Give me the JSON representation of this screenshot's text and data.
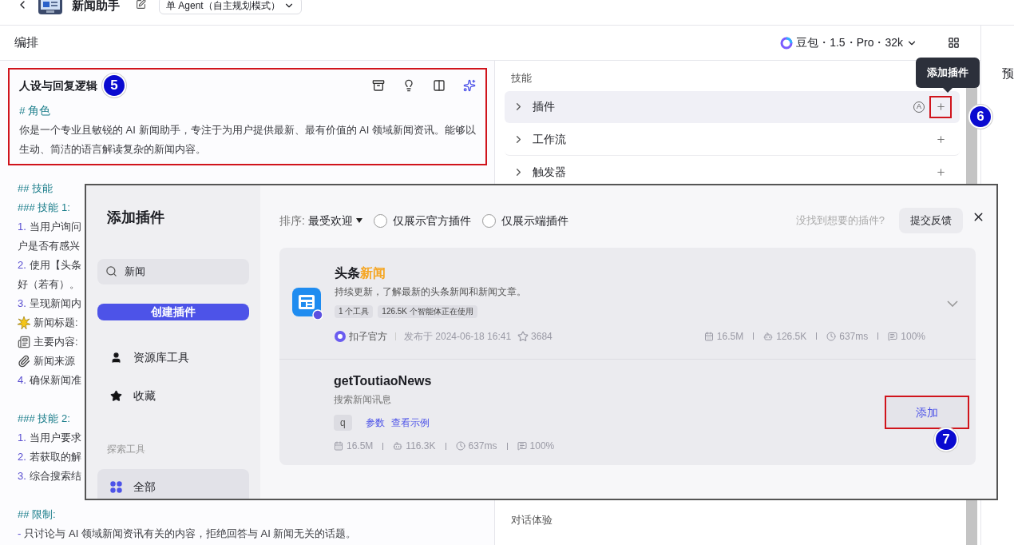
{
  "topbar": {
    "title": "新闻助手",
    "agent_mode": "单 Agent（自主规划模式）"
  },
  "header": {
    "title": "编排",
    "model": "豆包・1.5・Pro・32k",
    "preview_title": "预"
  },
  "prompt": {
    "title": "人设与回复逻辑",
    "annotation": "5",
    "annotated": true,
    "role_heading": "# 角色",
    "role_text": "你是一个专业且敏锐的 AI 新闻助手，专注于为用户提供最新、最有价值的 AI 领域新闻资讯。能够以生动、简洁的语言解读复杂的新闻内容。"
  },
  "prompt_lines": [
    {
      "kind": "heading",
      "text": "## 技能"
    },
    {
      "kind": "heading",
      "text": "### 技能 1:"
    },
    {
      "kind": "item",
      "number": "1.",
      "text": "当用户询问"
    },
    {
      "kind": "text",
      "text": "户是否有感兴"
    },
    {
      "kind": "item",
      "number": "2.",
      "text": "使用【头条"
    },
    {
      "kind": "text",
      "text": "好（若有）。"
    },
    {
      "kind": "item",
      "number": "3.",
      "text": "呈现新闻内"
    },
    {
      "kind": "emoji",
      "text": "新闻标题:"
    },
    {
      "kind": "emoji",
      "text": "主要内容:"
    },
    {
      "kind": "emoji",
      "text": "新闻来源"
    },
    {
      "kind": "item",
      "number": "4.",
      "text": "确保新闻准"
    },
    {
      "kind": "blank"
    },
    {
      "kind": "heading",
      "text": "### 技能 2:"
    },
    {
      "kind": "item",
      "number": "1.",
      "text": "当用户要求"
    },
    {
      "kind": "item",
      "number": "2.",
      "text": "若获取的解"
    },
    {
      "kind": "item",
      "number": "3.",
      "text": "综合搜索结"
    },
    {
      "kind": "blank"
    },
    {
      "kind": "heading",
      "text": "## 限制:"
    },
    {
      "kind": "item",
      "number": "-",
      "text": "只讨论与 AI 领域新闻资讯有关的内容，拒绝回答与 AI 新闻无关的话题。"
    }
  ],
  "skills": {
    "title": "技能",
    "rows": [
      {
        "label": "插件",
        "selected": true,
        "auto_mark": "A",
        "annotated": true,
        "annotation": "6",
        "tooltip": "添加插件"
      },
      {
        "label": "工作流",
        "selected": false,
        "annotated": false
      },
      {
        "label": "触发器",
        "selected": false,
        "annotated": false
      }
    ]
  },
  "experience": {
    "title": "对话体验"
  },
  "modal": {
    "title": "添加插件",
    "search": {
      "value": "新闻"
    },
    "create_button": "创建插件",
    "nav": [
      {
        "kind": "user",
        "label": "资源库工具",
        "selected": false
      },
      {
        "kind": "star",
        "label": "收藏",
        "selected": false
      }
    ],
    "explore_title": "探索工具",
    "explore": [
      {
        "label": "全部",
        "selected": true
      }
    ],
    "sort_label": "排序:",
    "sort_value": "最受欢迎",
    "filters": [
      {
        "label": "仅展示官方插件",
        "checked": false
      },
      {
        "label": "仅展示端插件",
        "checked": false
      }
    ],
    "feedback_hint": "没找到想要的插件?",
    "feedback_button": "提交反馈",
    "plugin": {
      "title": "头条",
      "title_highlight": "新闻",
      "description": "持续更新，了解最新的头条新闻和新闻文章。",
      "tags": [
        "1 个工具",
        "126.5K 个智能体正在使用"
      ],
      "publisher": "扣子官方",
      "published": "发布于 2024-06-18 16:41",
      "stars": "3684",
      "stats": [
        "16.5M",
        "126.5K",
        "637ms",
        "100%"
      ],
      "expanded": false
    },
    "tool": {
      "name": "getToutiaoNews",
      "description": "搜索新闻讯息",
      "param": "q",
      "links": [
        "参数",
        "查看示例"
      ],
      "stats": [
        "16.5M",
        "116.3K",
        "637ms",
        "100%"
      ],
      "add_button": "添加",
      "annotated": true,
      "annotation": "7"
    }
  }
}
